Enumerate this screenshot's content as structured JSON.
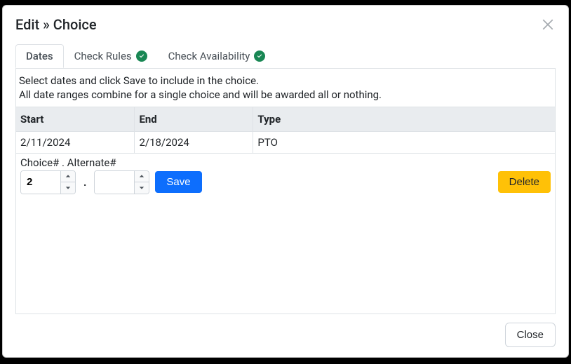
{
  "modal": {
    "title": "Edit » Choice",
    "close_button": "Close"
  },
  "tabs": {
    "dates": "Dates",
    "check_rules": "Check Rules",
    "check_availability": "Check Availability",
    "check_rules_status": "ok",
    "check_availability_status": "ok"
  },
  "help": {
    "line1": "Select dates and click Save to include in the choice.",
    "line2": "All date ranges combine for a single choice and will be awarded all or nothing."
  },
  "table": {
    "headers": {
      "start": "Start",
      "end": "End",
      "type": "Type"
    },
    "rows": [
      {
        "start": "2/11/2024",
        "end": "2/18/2024",
        "type": "PTO"
      }
    ]
  },
  "controls": {
    "label": "Choice# . Alternate#",
    "choice_value": "2",
    "alternate_value": "",
    "save_label": "Save",
    "delete_label": "Delete"
  },
  "footer": {
    "close_label": "Close"
  },
  "colors": {
    "primary": "#0d6efd",
    "warning": "#ffc107",
    "success": "#198754"
  }
}
